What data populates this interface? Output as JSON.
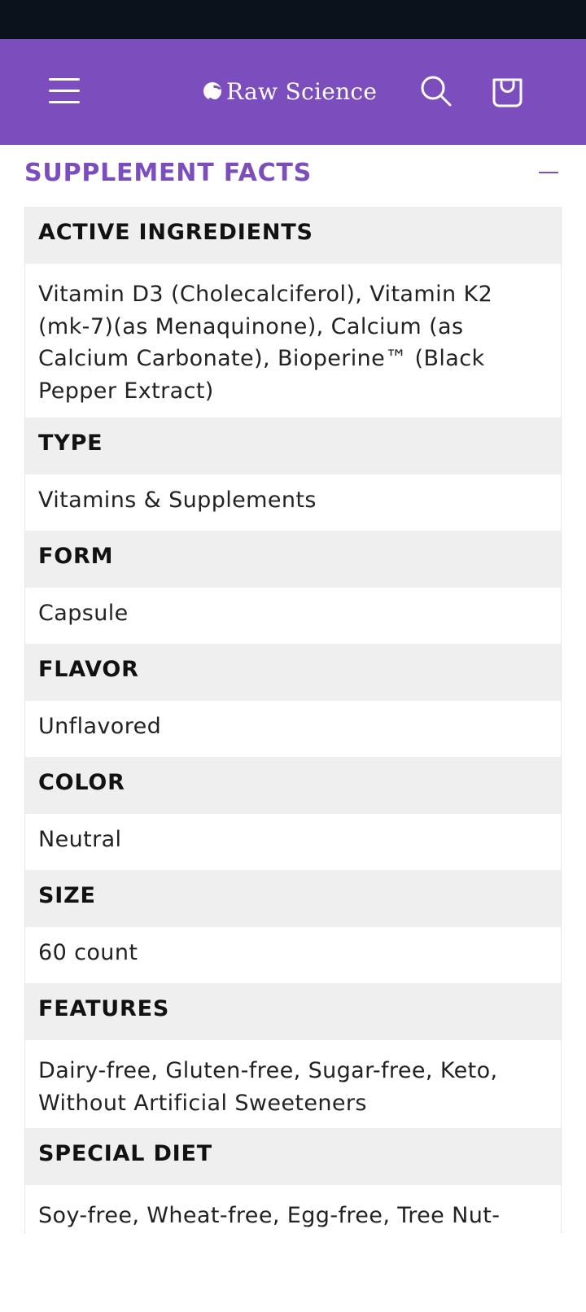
{
  "header": {
    "brand": "Raw Science",
    "menu_icon": "hamburger-menu-icon",
    "search_icon": "search-icon",
    "cart_icon": "shopping-bag-icon",
    "background_color": "#7c4dbd"
  },
  "section": {
    "title": "SUPPLEMENT FACTS",
    "toggle_icon": "minus-icon"
  },
  "facts": [
    {
      "label": "ACTIVE INGREDIENTS",
      "value": "Vitamin D3 (Cholecalciferol), Vitamin K2 (mk-7)(as Menaquinone), Calcium (as Calcium Carbonate), Bioperine™ (Black Pepper Extract)"
    },
    {
      "label": "TYPE",
      "value": "Vitamins & Supplements"
    },
    {
      "label": "FORM",
      "value": "Capsule"
    },
    {
      "label": "FLAVOR",
      "value": "Unflavored"
    },
    {
      "label": "COLOR",
      "value": "Neutral"
    },
    {
      "label": "SIZE",
      "value": "60 count"
    },
    {
      "label": "FEATURES",
      "value": "Dairy-free, Gluten-free, Sugar-free, Keto, Without Artificial Sweeteners"
    },
    {
      "label": "SPECIAL DIET",
      "value": "Soy-free, Wheat-free, Egg-free, Tree Nut-free, Shellfish-free, Fish-free, Peanut-free"
    }
  ],
  "colors": {
    "accent": "#7c4dbd",
    "row_header_bg": "#efefef",
    "status_bar": "#0b121c"
  }
}
